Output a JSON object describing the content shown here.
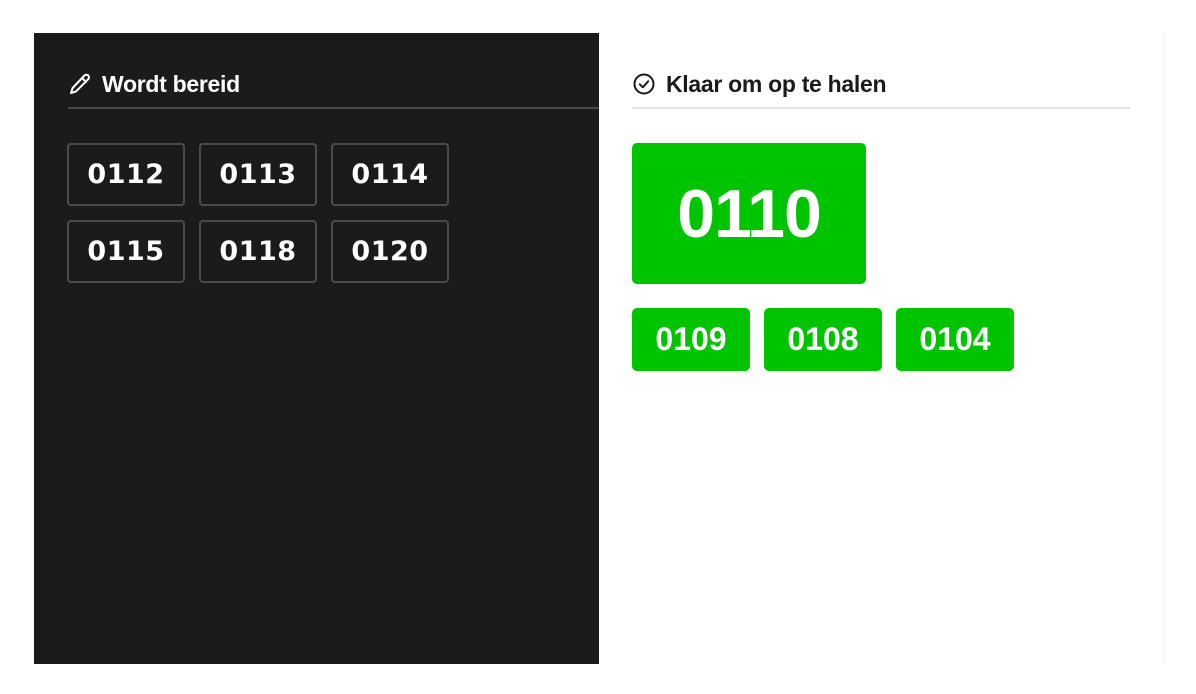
{
  "preparing": {
    "title": "Wordt bereid",
    "icon": "pen-icon",
    "orders": [
      "0112",
      "0113",
      "0114",
      "0115",
      "0118",
      "0120"
    ]
  },
  "ready": {
    "title": "Klaar om op te halen",
    "icon": "check-circle-icon",
    "featured_order": "0110",
    "orders": [
      "0109",
      "0108",
      "0104"
    ]
  },
  "colors": {
    "dark_panel": "#1b1b1b",
    "ready_green": "#00c400",
    "text_light": "#ffffff",
    "text_dark": "#1a1a1a"
  }
}
